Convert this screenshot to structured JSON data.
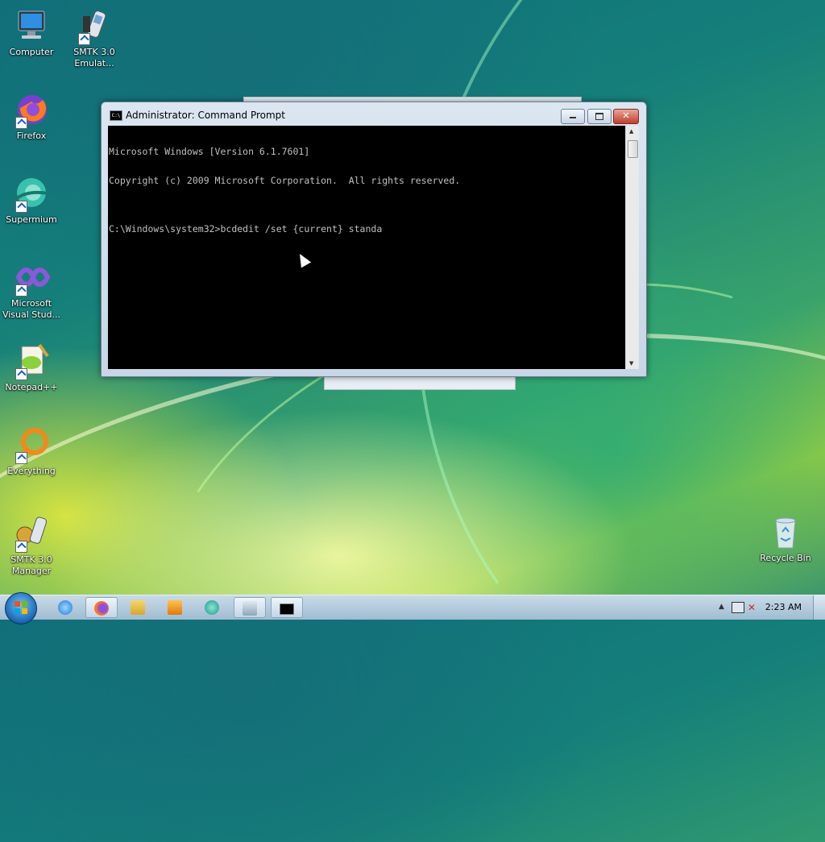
{
  "desktop": {
    "icons": [
      {
        "label": "Computer",
        "icon": "computer-icon"
      },
      {
        "label": "SMTK 3.0 Emulat...",
        "icon": "smtk-emulator-icon"
      },
      {
        "label": "Firefox",
        "icon": "firefox-icon"
      },
      {
        "label": "Supermium",
        "icon": "supermium-icon"
      },
      {
        "label": "Microsoft Visual Stud...",
        "icon": "visual-studio-icon"
      },
      {
        "label": "Notepad++",
        "icon": "notepadpp-icon"
      },
      {
        "label": "Everything",
        "icon": "everything-icon"
      },
      {
        "label": "SMTK 3.0 Manager",
        "icon": "smtk-manager-icon"
      },
      {
        "label": "Recycle Bin",
        "icon": "recycle-bin-icon"
      }
    ]
  },
  "cmd_window": {
    "title": "Administrator: Command Prompt",
    "icon_text": "C:\\",
    "lines": [
      "Microsoft Windows [Version 6.1.7601]",
      "Copyright (c) 2009 Microsoft Corporation.  All rights reserved.",
      "",
      "C:\\Windows\\system32>bcdedit /set {current} standa"
    ]
  },
  "taskbar": {
    "items": [
      "start-orb",
      "internet-explorer-icon",
      "firefox-icon",
      "explorer-icon",
      "media-player-icon",
      "supermium-icon",
      "remote-desktop-icon",
      "cmd-icon"
    ],
    "clock": "2:23 AM"
  },
  "colors": {
    "console_bg": "#000000",
    "console_fg": "#c0c0c0",
    "close_button": "#c0402d"
  }
}
